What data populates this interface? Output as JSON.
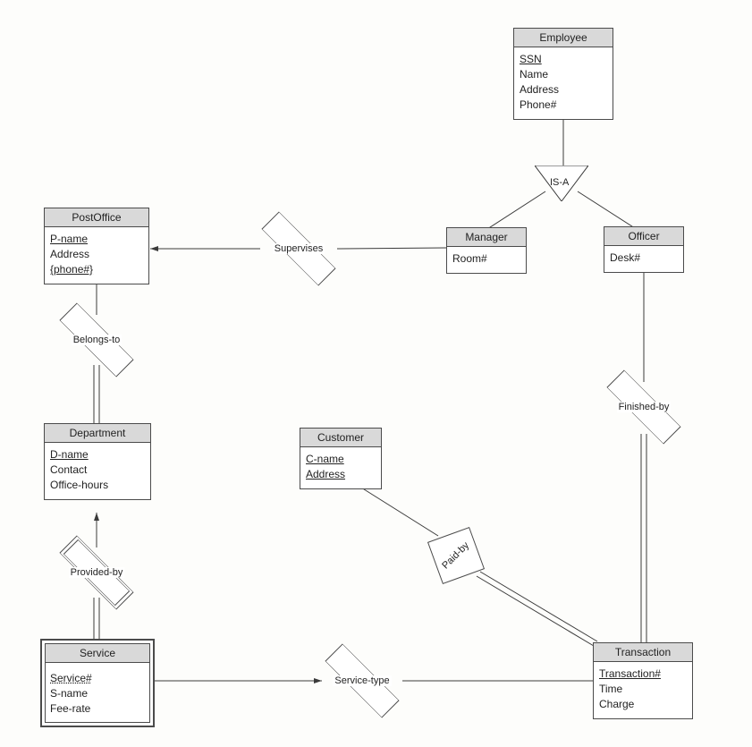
{
  "entities": {
    "employee": {
      "title": "Employee",
      "attrs": [
        "SSN",
        "Name",
        "Address",
        "Phone#"
      ],
      "pk": [
        0
      ]
    },
    "postoffice": {
      "title": "PostOffice",
      "attrs": [
        "P-name",
        "Address",
        "{phone#}"
      ],
      "pk": [
        0
      ]
    },
    "manager": {
      "title": "Manager",
      "attrs": [
        "Room#"
      ]
    },
    "officer": {
      "title": "Officer",
      "attrs": [
        "Desk#"
      ]
    },
    "department": {
      "title": "Department",
      "attrs": [
        "D-name",
        "Contact",
        "Office-hours"
      ],
      "pk": [
        0
      ]
    },
    "customer": {
      "title": "Customer",
      "attrs": [
        "C-name",
        "Address"
      ],
      "pk": [
        0,
        1
      ]
    },
    "service": {
      "title": "Service",
      "attrs": [
        "Service#",
        "S-name",
        "Fee-rate"
      ]
    },
    "transaction": {
      "title": "Transaction",
      "attrs": [
        "Transaction#",
        "Time",
        "Charge"
      ],
      "pk": [
        0
      ]
    }
  },
  "relationships": {
    "supervises": {
      "label": "Supervises"
    },
    "belongs_to": {
      "label": "Belongs-to"
    },
    "provided_by": {
      "label": "Provided-by"
    },
    "service_type": {
      "label": "Service-type"
    },
    "finished_by": {
      "label": "Finished-by"
    },
    "paid_by": {
      "label": "Paid-by"
    },
    "isa": {
      "label": "IS-A"
    }
  },
  "chart_data": {
    "type": "er-diagram",
    "entities": [
      {
        "name": "Employee",
        "attributes": [
          "SSN",
          "Name",
          "Address",
          "Phone#"
        ],
        "keys": [
          "SSN"
        ]
      },
      {
        "name": "PostOffice",
        "attributes": [
          "P-name",
          "Address",
          "{phone#}"
        ],
        "keys": [
          "P-name"
        ]
      },
      {
        "name": "Manager",
        "attributes": [
          "Room#"
        ],
        "subtype_of": "Employee"
      },
      {
        "name": "Officer",
        "attributes": [
          "Desk#"
        ],
        "subtype_of": "Employee"
      },
      {
        "name": "Department",
        "attributes": [
          "D-name",
          "Contact",
          "Office-hours"
        ],
        "keys": [
          "D-name"
        ]
      },
      {
        "name": "Customer",
        "attributes": [
          "C-name",
          "Address"
        ],
        "keys": [
          "C-name",
          "Address"
        ],
        "weak": true
      },
      {
        "name": "Service",
        "attributes": [
          "Service#",
          "S-name",
          "Fee-rate"
        ],
        "weak": true,
        "partial_key": [
          "Service#"
        ]
      },
      {
        "name": "Transaction",
        "attributes": [
          "Transaction#",
          "Time",
          "Charge"
        ],
        "keys": [
          "Transaction#"
        ]
      }
    ],
    "relationships": [
      {
        "name": "IS-A",
        "from": "Employee",
        "to": [
          "Manager",
          "Officer"
        ],
        "type": "generalization"
      },
      {
        "name": "Supervises",
        "between": [
          "Manager",
          "PostOffice"
        ]
      },
      {
        "name": "Belongs-to",
        "between": [
          "Department",
          "PostOffice"
        ],
        "total": [
          "Department"
        ]
      },
      {
        "name": "Provided-by",
        "between": [
          "Service",
          "Department"
        ],
        "identifying": true,
        "total": [
          "Service"
        ]
      },
      {
        "name": "Service-type",
        "between": [
          "Transaction",
          "Service"
        ]
      },
      {
        "name": "Paid-by",
        "between": [
          "Transaction",
          "Customer"
        ],
        "total": [
          "Transaction"
        ]
      },
      {
        "name": "Finished-by",
        "between": [
          "Transaction",
          "Officer"
        ],
        "total": [
          "Transaction"
        ]
      }
    ]
  }
}
